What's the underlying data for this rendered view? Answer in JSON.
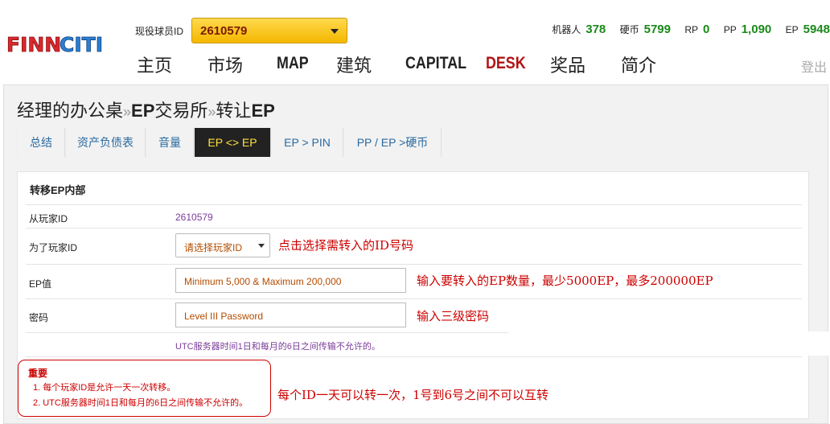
{
  "header": {
    "logo_text": "FINNCITI",
    "player_label": "现役球员ID",
    "player_id": "2610579",
    "stats": [
      {
        "label": "机器人",
        "value": "378"
      },
      {
        "label": "硬币",
        "value": "5799"
      },
      {
        "label": "RP",
        "value": "0"
      },
      {
        "label": "PP",
        "value": "1,090"
      },
      {
        "label": "EP",
        "value": "5948"
      }
    ],
    "nav": [
      "主页",
      "市场",
      "MAP",
      "建筑",
      "CAPITAL",
      "DESK",
      "奖品",
      "简介"
    ],
    "logout": "登出"
  },
  "breadcrumb": {
    "part1": "经理的办公桌",
    "sep": "»",
    "part2": "EP",
    "part3": "交易所",
    "part4": "转让",
    "part5": "EP"
  },
  "tabs": [
    "总结",
    "资产负债表",
    "音量",
    "EP <> EP",
    "EP > PIN",
    "PP / EP >硬币"
  ],
  "active_tab": "EP <> EP",
  "form": {
    "title": "转移EP内部",
    "from_label": "从玩家ID",
    "from_value": "2610579",
    "to_label": "为了玩家ID",
    "to_select": "请选择玩家ID",
    "ep_label": "EP值",
    "ep_placeholder": "Minimum 5,000 & Maximum 200,000",
    "pwd_label": "密码",
    "pwd_placeholder": "Level III Password",
    "utc_note": "UTC服务器时间1日和每月的6日之间传输不允许的。"
  },
  "hints": {
    "to": "点击选择需转入的ID号码",
    "ep": "输入要转入的EP数量，最少5000EP，最多200000EP",
    "pwd": "输入三级密码",
    "bottom": "每个ID一天可以转一次，1号到6号之间不可以互转"
  },
  "important": {
    "title": "重要",
    "items": [
      "1.  每个玩家ID是允许一天一次转移。",
      "2.  UTC服务器时间1日和每月的6日之间传输不允许的。"
    ]
  },
  "colors": {
    "active_tab_bg": "#222222",
    "active_tab_text": "#ffe23b",
    "stat_number": "#1a8a1a",
    "hint_red": "#cc0000",
    "desk_red": "#b01414"
  }
}
